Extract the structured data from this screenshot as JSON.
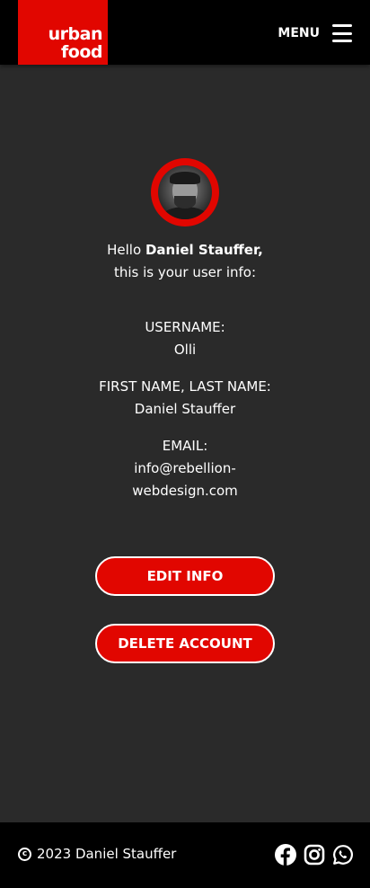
{
  "brand": {
    "logo_line1": "urban",
    "logo_line2": "food",
    "accent_color": "#e10600"
  },
  "header": {
    "menu_label": "MENU",
    "menu_icon": "hamburger-icon"
  },
  "profile": {
    "avatar_icon": "user-avatar",
    "greeting_prefix": "Hello",
    "greeting_name": "Daniel Stauffer,",
    "greeting_line2": "this is your user info:",
    "username_label": "USERNAME:",
    "username_value": "Olli",
    "fullname_label": "FIRST NAME, LAST NAME:",
    "fullname_value": "Daniel Stauffer",
    "email_label": "EMAIL:",
    "email_value_line1": "info@rebellion-",
    "email_value_line2": "webdesign.com"
  },
  "actions": {
    "edit_label": "EDIT INFO",
    "delete_label": "DELETE ACCOUNT"
  },
  "footer": {
    "copyright_symbol": "c",
    "copyright_text": "2023 Daniel Stauffer",
    "social_icons": [
      "facebook-icon",
      "instagram-icon",
      "whatsapp-icon"
    ]
  }
}
